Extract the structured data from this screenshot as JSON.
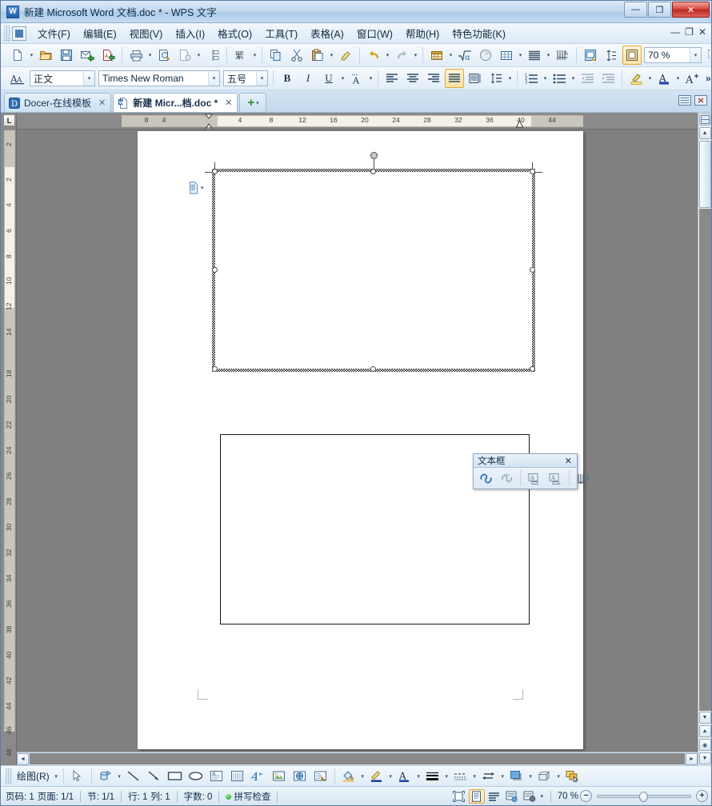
{
  "window": {
    "title": "新建 Microsoft Word 文档.doc * - WPS 文字",
    "app_icon": "W",
    "minimize": "—",
    "maximize": "❐",
    "close": "✕"
  },
  "menubar": {
    "items": [
      {
        "label": "文件(F)",
        "name": "menu-file"
      },
      {
        "label": "编辑(E)",
        "name": "menu-edit"
      },
      {
        "label": "视图(V)",
        "name": "menu-view"
      },
      {
        "label": "插入(I)",
        "name": "menu-insert"
      },
      {
        "label": "格式(O)",
        "name": "menu-format"
      },
      {
        "label": "工具(T)",
        "name": "menu-tools"
      },
      {
        "label": "表格(A)",
        "name": "menu-table"
      },
      {
        "label": "窗口(W)",
        "name": "menu-window"
      },
      {
        "label": "帮助(H)",
        "name": "menu-help"
      },
      {
        "label": "特色功能(K)",
        "name": "menu-features"
      }
    ],
    "mdi_minimize": "—",
    "mdi_restore": "❐",
    "mdi_close": "✕"
  },
  "standard_toolbar": {
    "zoom_value": "70 %",
    "overflow_label": "»",
    "buttons": [
      "new-document-icon",
      "open-folder-icon",
      "save-icon",
      "email-icon",
      "export-pdf-icon",
      "print-icon",
      "print-preview-icon",
      "document-permission-icon",
      "compare-icon",
      "traditional-chinese-icon",
      "copy-icon",
      "cut-icon",
      "paste-icon",
      "format-painter-icon",
      "undo-icon",
      "redo-icon",
      "insert-table-icon",
      "formula-icon",
      "insert-chart-icon",
      "table-grid-icon",
      "paragraph-layout-icon",
      "show-marks-icon",
      "header-footer-icon",
      "line-spacing-icon",
      "fullscreen-icon",
      "selection-tool-icon"
    ]
  },
  "format_toolbar": {
    "style_value": "正文",
    "font_value": "Times New Roman",
    "size_value": "五号",
    "bold_label": "B",
    "italic_label": "I",
    "underline_label": "U",
    "char_border_label": "A",
    "font_color_label": "A",
    "grow_font_label": "A",
    "overflow_label": "»",
    "buttons": [
      "styles-icon",
      "bold-icon",
      "italic-icon",
      "underline-icon",
      "character-border-icon",
      "align-left-icon",
      "align-center-icon",
      "align-right-icon",
      "align-justify-icon",
      "distribute-icon",
      "line-spacing-icon",
      "numbered-list-icon",
      "bulleted-list-icon",
      "decrease-indent-icon",
      "increase-indent-icon",
      "highlight-icon",
      "font-color-icon",
      "grow-font-icon",
      "insert-table-icon"
    ]
  },
  "tabs": {
    "items": [
      {
        "label": "Docer-在线模板",
        "icon": "docer-icon",
        "active": false,
        "close": "✕"
      },
      {
        "label": "新建 Micr...档.doc *",
        "icon": "word-doc-icon",
        "active": true,
        "close": "✕"
      }
    ],
    "add_label": "+",
    "add_caret": "▾"
  },
  "ruler": {
    "horizontal_ticks": [
      "8",
      "4",
      "4",
      "8",
      "12",
      "16",
      "20",
      "24",
      "28",
      "32",
      "36",
      "40",
      "44"
    ],
    "vertical_ticks": [
      "2",
      "2",
      "4",
      "6",
      "8",
      "10",
      "12",
      "14",
      "18",
      "20",
      "22",
      "24",
      "26",
      "28",
      "30",
      "32",
      "34",
      "36",
      "38",
      "40",
      "42",
      "44",
      "46",
      "48"
    ],
    "corner_label": "L"
  },
  "document": {
    "page_number_hint": "1",
    "textbox": {
      "name": "selected-text-box",
      "state": "selected",
      "content": ""
    },
    "rectangle": {
      "name": "rectangle-shape",
      "content": ""
    }
  },
  "float_toolbar": {
    "title": "文本框",
    "close": "✕",
    "buttons": [
      "create-text-box-link-icon",
      "break-forward-link-icon",
      "previous-text-box-icon",
      "next-text-box-icon",
      "change-text-direction-icon"
    ]
  },
  "drawing_toolbar": {
    "label": "绘图(R)",
    "caret": "▾",
    "buttons": [
      "select-objects-icon",
      "autoshapes-icon",
      "line-icon",
      "arrow-icon",
      "rectangle-icon",
      "oval-icon",
      "text-box-icon",
      "vertical-text-box-icon",
      "word-art-icon",
      "insert-picture-icon",
      "clip-art-icon",
      "diagram-icon",
      "fill-color-icon",
      "line-color-icon",
      "font-color-icon",
      "line-style-icon",
      "dash-style-icon",
      "arrow-style-icon",
      "shadow-style-icon",
      "3d-style-icon",
      "select-multiple-objects-icon"
    ]
  },
  "statusbar": {
    "page_label": "页码: 1",
    "pages_label": "页面: 1/1",
    "section_label": "节: 1/1",
    "row_label": "行: 1",
    "col_label": "列: 1",
    "words_label": "字数: 0",
    "spellcheck_label": "拼写检查",
    "zoom_value": "70 %",
    "zoom_out": "−",
    "zoom_in": "+",
    "views": [
      {
        "name": "full-screen-view-button",
        "active": false
      },
      {
        "name": "page-view-button",
        "active": true
      },
      {
        "name": "outline-view-button",
        "active": false
      },
      {
        "name": "web-layout-view-button",
        "active": false
      },
      {
        "name": "reading-layout-view-button",
        "active": false
      }
    ]
  },
  "colors": {
    "accent": "#e0a93c",
    "title_text": "#0d2a4a",
    "page_bg": "#808080",
    "close_red": "#d4433a"
  }
}
